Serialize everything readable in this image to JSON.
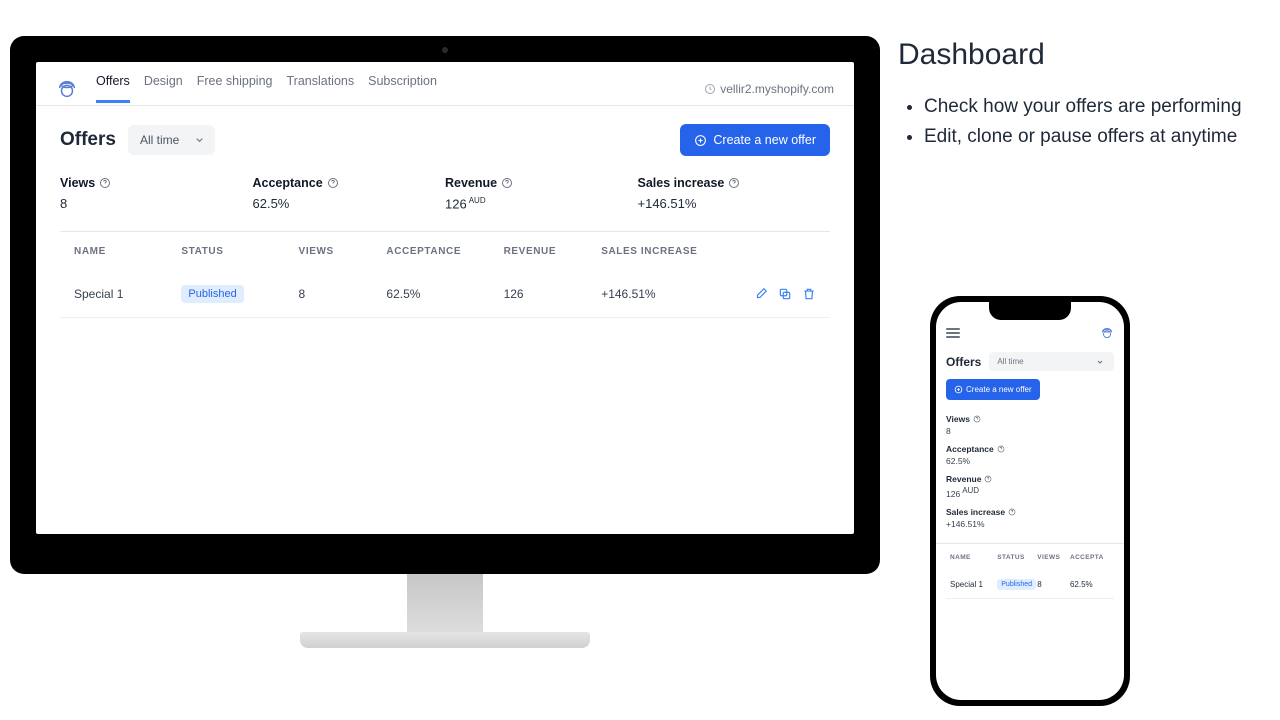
{
  "right": {
    "headline": "Dashboard",
    "bullets": [
      "Check how your offers are performing",
      "Edit, clone or pause offers at anytime"
    ]
  },
  "nav": {
    "items": [
      "Offers",
      "Design",
      "Free shipping",
      "Translations",
      "Subscription"
    ],
    "shop_url": "vellir2.myshopify.com"
  },
  "page": {
    "title": "Offers",
    "time_filter": "All time",
    "create_label": "Create a new offer"
  },
  "metrics": {
    "views": {
      "label": "Views",
      "value": "8"
    },
    "acceptance": {
      "label": "Acceptance",
      "value": "62.5%"
    },
    "revenue": {
      "label": "Revenue",
      "value": "126",
      "currency": "AUD"
    },
    "sales_increase": {
      "label": "Sales increase",
      "value": "+146.51%"
    }
  },
  "table": {
    "cols": [
      "NAME",
      "STATUS",
      "VIEWS",
      "ACCEPTANCE",
      "REVENUE",
      "SALES INCREASE"
    ],
    "row": {
      "name": "Special 1",
      "status": "Published",
      "views": "8",
      "acceptance": "62.5%",
      "revenue": "126",
      "sales_increase": "+146.51%"
    }
  },
  "mobile_cols": [
    "NAME",
    "STATUS",
    "VIEWS",
    "ACCEPTA"
  ]
}
